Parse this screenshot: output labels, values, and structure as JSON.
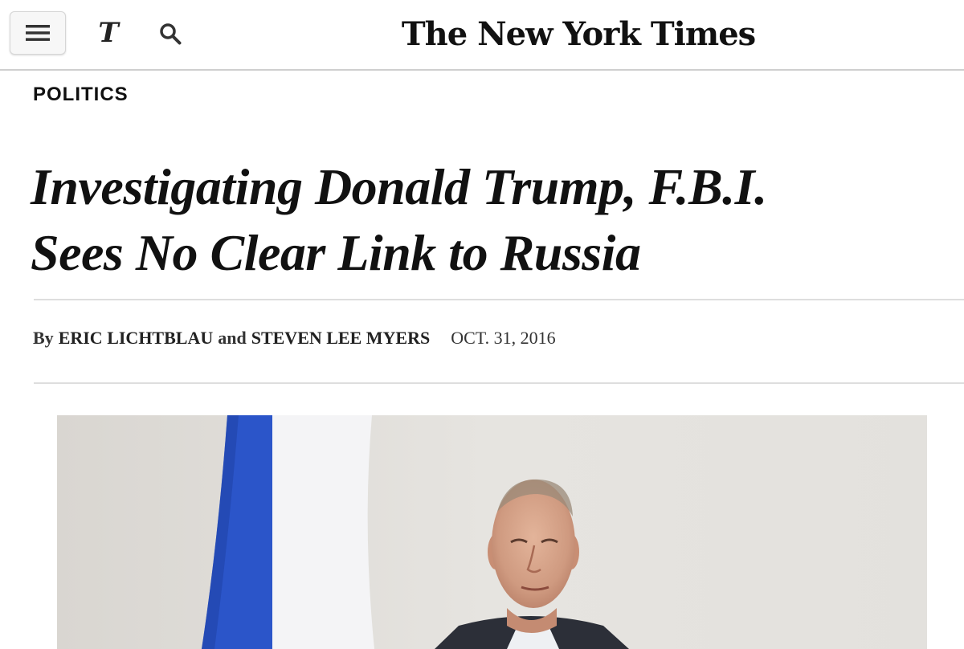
{
  "header": {
    "menu_icon": "hamburger-menu-icon",
    "t_logo_text": "T",
    "search_icon": "search-icon",
    "masthead": "The New York Times"
  },
  "article": {
    "section": "POLITICS",
    "headline_line1": "Investigating Donald Trump, F.B.I.",
    "headline_line2": "Sees No Clear Link to Russia",
    "byline_prefix": "By",
    "author1": "ERIC LICHTBLAU",
    "byline_conjunction": "and",
    "author2": "STEVEN LEE MYERS",
    "date": "OCT. 31, 2016"
  },
  "colors": {
    "text": "#111111",
    "rule": "#dedede",
    "flag_blue": "#2b55c9",
    "flag_white": "#f4f4f6"
  }
}
